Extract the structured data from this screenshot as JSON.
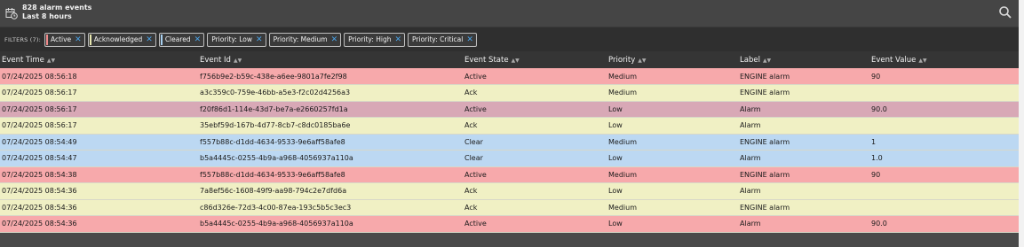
{
  "header": {
    "count_text": "828 alarm events",
    "range_text": "Last 8 hours"
  },
  "filters": {
    "label": "FILTERS (7):",
    "chips": [
      {
        "label": "Active",
        "accent": "#f08b8b"
      },
      {
        "label": "Acknowledged",
        "accent": "#e8e8b0"
      },
      {
        "label": "Cleared",
        "accent": "#a8d0f0"
      },
      {
        "label": "Priority: Low",
        "accent": ""
      },
      {
        "label": "Priority: Medium",
        "accent": ""
      },
      {
        "label": "Priority: High",
        "accent": ""
      },
      {
        "label": "Priority: Critical",
        "accent": ""
      }
    ]
  },
  "table": {
    "columns": [
      "Event Time",
      "Event Id",
      "Event State",
      "Priority",
      "Label",
      "Event Value"
    ],
    "rows": [
      {
        "time": "07/24/2025 08:56:18",
        "id": "f756b9e2-b59c-438e-a6ee-9801a7fe2f98",
        "state": "Active",
        "priority": "Medium",
        "label": "ENGINE alarm",
        "value": "90",
        "color": "#f7a9ab"
      },
      {
        "time": "07/24/2025 08:56:17",
        "id": "a3c359c0-759e-46bb-a5e3-f2c02d4256a3",
        "state": "Ack",
        "priority": "Medium",
        "label": "ENGINE alarm",
        "value": "",
        "color": "#f0f0c4"
      },
      {
        "time": "07/24/2025 08:56:17",
        "id": "f20f86d1-114e-43d7-be7a-e2660257fd1a",
        "state": "Active",
        "priority": "Low",
        "label": "Alarm",
        "value": "90.0",
        "color": "#d8a8b6"
      },
      {
        "time": "07/24/2025 08:56:17",
        "id": "35ebf59d-167b-4d77-8cb7-c8dc0185ba6e",
        "state": "Ack",
        "priority": "Low",
        "label": "Alarm",
        "value": "",
        "color": "#f0f0c4"
      },
      {
        "time": "07/24/2025 08:54:49",
        "id": "f557b88c-d1dd-4634-9533-9e6aff58afe8",
        "state": "Clear",
        "priority": "Medium",
        "label": "ENGINE alarm",
        "value": "1",
        "color": "#bcd8f2"
      },
      {
        "time": "07/24/2025 08:54:47",
        "id": "b5a4445c-0255-4b9a-a968-4056937a110a",
        "state": "Clear",
        "priority": "Low",
        "label": "Alarm",
        "value": "1.0",
        "color": "#bcd8f2"
      },
      {
        "time": "07/24/2025 08:54:38",
        "id": "f557b88c-d1dd-4634-9533-9e6aff58afe8",
        "state": "Active",
        "priority": "Medium",
        "label": "ENGINE alarm",
        "value": "90",
        "color": "#f7a9ab"
      },
      {
        "time": "07/24/2025 08:54:36",
        "id": "7a8ef56c-1608-49f9-aa98-794c2e7dfd6a",
        "state": "Ack",
        "priority": "Low",
        "label": "Alarm",
        "value": "",
        "color": "#f0f0c4"
      },
      {
        "time": "07/24/2025 08:54:36",
        "id": "c86d326e-72d3-4c00-87ea-193c5b5c3ec3",
        "state": "Ack",
        "priority": "Medium",
        "label": "ENGINE alarm",
        "value": "",
        "color": "#f0f0c4"
      },
      {
        "time": "07/24/2025 08:54:36",
        "id": "b5a4445c-0255-4b9a-a968-4056937a110a",
        "state": "Active",
        "priority": "Low",
        "label": "Alarm",
        "value": "90.0",
        "color": "#f7a9ab"
      }
    ]
  },
  "icons": {
    "header": "calendar-clock-icon",
    "search": "search-icon",
    "sort": "sort-icon",
    "chip_remove": "close-icon"
  }
}
